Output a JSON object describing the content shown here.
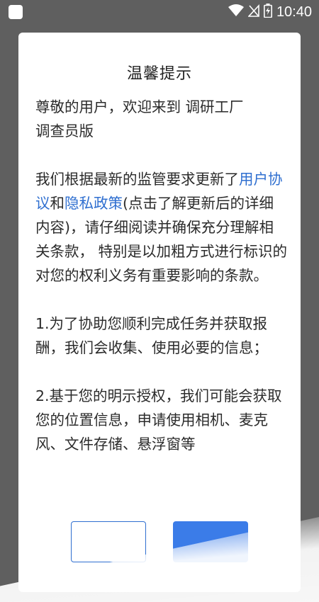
{
  "status_bar": {
    "time": "10:40",
    "icons": [
      "app-square-icon",
      "wifi-icon",
      "no-signal-icon",
      "battery-charging-icon"
    ]
  },
  "dialog": {
    "title": "温馨提示",
    "greeting_1": "尊敬的用户，欢迎来到 调研工厂",
    "greeting_2": "调查员版",
    "para2_part1": "我们根据最新的监管要求更新了",
    "link_user_agreement": "用户协议",
    "and_text": "和",
    "link_privacy_policy": "隐私政策",
    "para2_part2": "(点击了解更新后的详细内容)，请仔细阅读并确保充分理解相关条款， 特别是以加粗方式进行标识的对您的权利义务有重要影响的条款。",
    "item1": "1.为了协助您顺利完成任务并获取报酬，我们会收集、使用必要的信息；",
    "item2": "2.基于您的明示授权，我们可能会获取您的位置信息，申请使用相机、麦克风、文件存储、悬浮窗等"
  },
  "colors": {
    "link": "#2f6fd0",
    "primary_button": "#3b7ce8",
    "overlay_bg": "#5f5f5f"
  }
}
